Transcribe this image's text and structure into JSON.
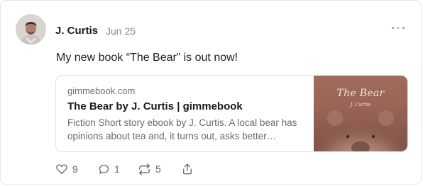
{
  "post": {
    "author": "J. Curtis",
    "date": "Jun 25",
    "text": "My new book “The Bear” is out now!"
  },
  "link_preview": {
    "domain": "gimmebook.com",
    "title": "The Bear by J. Curtis | gimmebook",
    "description": "Fiction Short story ebook by J. Curtis. A local bear has opinions about tea and, it turns out, asks better…",
    "cover_title": "The Bear",
    "cover_author": "J. Curtis"
  },
  "actions": {
    "likes": "9",
    "comments": "1",
    "restacks": "5"
  },
  "icons": [
    "more-icon",
    "heart-icon",
    "comment-icon",
    "restack-icon",
    "share-icon"
  ],
  "colors": {
    "muted_text": "#8a8a8a",
    "border": "#e6e6e6",
    "cover": "#9a6456"
  }
}
